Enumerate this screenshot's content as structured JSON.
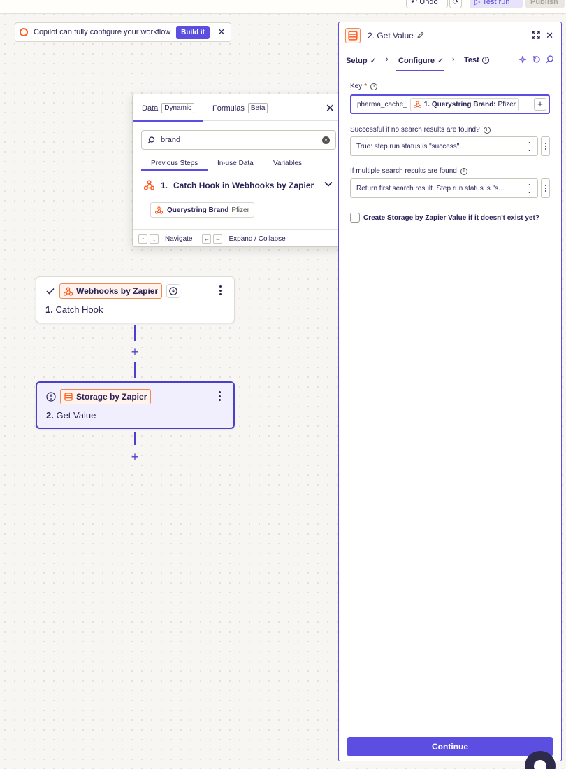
{
  "topbar": {
    "undo_label": "Undo",
    "test_run_label": "Test run",
    "publish_label": "Publish"
  },
  "copilot": {
    "message": "Copilot can fully configure your workflow",
    "build_label": "Build it",
    "close": "✕"
  },
  "canvas": {
    "nodes": [
      {
        "app": "Webhooks by Zapier",
        "number": "1.",
        "title": "Catch Hook",
        "status": "success"
      },
      {
        "app": "Storage by Zapier",
        "number": "2.",
        "title": "Get Value",
        "status": "warning"
      }
    ],
    "add_symbol": "+"
  },
  "picker": {
    "tabs": [
      {
        "label": "Data",
        "pill": "Dynamic"
      },
      {
        "label": "Formulas",
        "pill": "Beta"
      }
    ],
    "close": "✕",
    "search_value": "brand",
    "subtabs": [
      "Previous Steps",
      "In-use Data",
      "Variables"
    ],
    "step": {
      "number": "1.",
      "title": "Catch Hook in Webhooks by Zapier"
    },
    "field": {
      "name": "Querystring Brand",
      "value": "Pfizer"
    },
    "footer": {
      "navigate_label": "Navigate",
      "expand_label": "Expand / Collapse"
    }
  },
  "panel": {
    "title": "2. Get Value",
    "tabs": {
      "setup": "Setup",
      "configure": "Configure",
      "test": "Test"
    },
    "key_label": "Key",
    "key_required": "*",
    "key_prefix": "pharma_cache_",
    "key_mapped_step": "1. Querystring Brand:",
    "key_mapped_value": "Pfizer",
    "no_results_label": "Successful if no search results are found?",
    "no_results_value": "True: step run status is \"success\".",
    "multiple_label": "If multiple search results are found",
    "multiple_value": "Return first search result. Step run status is \"s...",
    "create_label": "Create Storage by Zapier Value if it doesn't exist yet?",
    "continue_label": "Continue"
  },
  "colors": {
    "accent": "#5b4ee0",
    "app_orange": "#ff5a1f",
    "text": "#2b2358"
  }
}
